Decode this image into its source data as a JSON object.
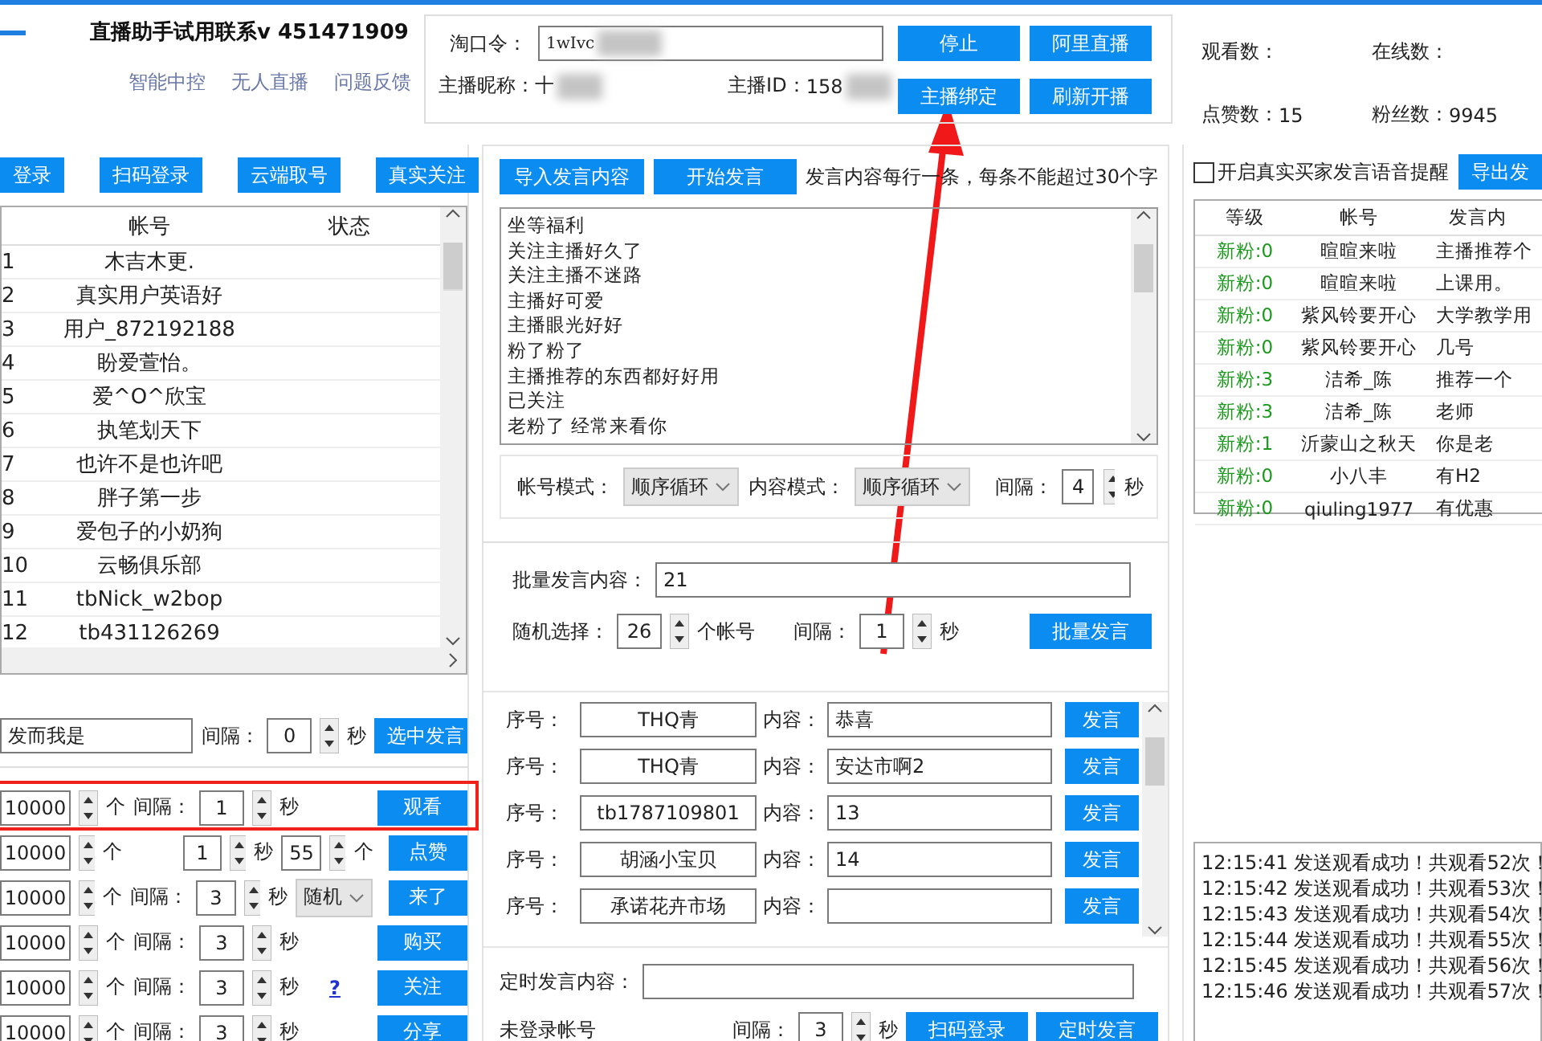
{
  "app": {
    "title": "直播助手试用联系v 451471909",
    "nav": [
      {
        "label": "智能中控"
      },
      {
        "label": "无人直播"
      },
      {
        "label": "问题反馈"
      }
    ]
  },
  "anchor": {
    "code_label": "淘口令：",
    "code_value": "1wIvc",
    "nickname_label": "主播昵称：",
    "nickname_value": "十",
    "id_label": "主播ID：",
    "id_value": "158",
    "buttons": [
      "停止",
      "阿里直播",
      "主播绑定",
      "刷新开播"
    ]
  },
  "stats": [
    {
      "label": "观看数："
    },
    {
      "label": "在线数："
    },
    {
      "label": "点赞数：",
      "value": "15"
    },
    {
      "label": "粉丝数：",
      "value": "9945"
    }
  ],
  "accounts": {
    "buttons": [
      "登录",
      "扫码登录",
      "云端取号",
      "真实关注"
    ],
    "columns": [
      "帐号",
      "状态"
    ],
    "rows": [
      {
        "index": "1",
        "account": "木吉木更."
      },
      {
        "index": "2",
        "account": "真实用户英语好"
      },
      {
        "index": "3",
        "account": "用户_872192188"
      },
      {
        "index": "4",
        "account": "盼爱萱怡。"
      },
      {
        "index": "5",
        "account": "爱^O^欣宝"
      },
      {
        "index": "6",
        "account": "执笔划天下"
      },
      {
        "index": "7",
        "account": "也许不是也许吧"
      },
      {
        "index": "8",
        "account": "胖子第一步"
      },
      {
        "index": "9",
        "account": "爱包子的小奶狗"
      },
      {
        "index": "10",
        "account": "云畅俱乐部"
      },
      {
        "index": "11",
        "account": "tbNick_w2bop"
      },
      {
        "index": "12",
        "account": "tb431126269"
      }
    ],
    "comment": "发而我是",
    "interval_label": "间隔：",
    "interval": "0",
    "unit": "秒",
    "send_button": "选中发言"
  },
  "actions": [
    {
      "count": "10000",
      "count_unit": "个",
      "label": "间隔：",
      "value": "1",
      "unit": "秒",
      "button": "观看"
    },
    {
      "count": "10000",
      "count_unit": "个",
      "value": "1",
      "unit": "秒",
      "amount": "55",
      "amount_unit": "个",
      "button": "点赞"
    },
    {
      "count": "10000",
      "count_unit": "个",
      "label": "间隔：",
      "value": "3",
      "unit": "秒",
      "option": "随机",
      "button": "来了"
    },
    {
      "count": "10000",
      "count_unit": "个",
      "label": "间隔：",
      "value": "3",
      "unit": "秒",
      "button": "购买"
    },
    {
      "count": "10000",
      "count_unit": "个",
      "label": "间隔：",
      "value": "3",
      "unit": "秒",
      "help": "?",
      "button": "关注"
    },
    {
      "count": "10000",
      "count_unit": "个",
      "label": "间隔：",
      "value": "3",
      "unit": "秒",
      "button": "分享"
    }
  ],
  "comments": {
    "import_button": "导入发言内容",
    "start_button": "开始发言",
    "hint": "发言内容每行一条，每条不能超过30个字",
    "lines": [
      "坐等福利",
      "关注主播好久了",
      "关注主播不迷路",
      "主播好可爱",
      "主播眼光好好",
      "粉了粉了",
      "主播推荐的东西都好好用",
      "已关注",
      "老粉了 经常来看你"
    ],
    "account_mode_label": "帐号模式：",
    "account_mode": "顺序循环",
    "content_mode_label": "内容模式：",
    "content_mode": "顺序循环",
    "interval_label": "间隔：",
    "interval": "4",
    "unit": "秒"
  },
  "batch": {
    "content_label": "批量发言内容：",
    "content": "21",
    "random_label": "随机选择：",
    "random": "26",
    "random_unit": "个帐号",
    "interval_label": "间隔：",
    "interval": "1",
    "unit": "秒",
    "button": "批量发言"
  },
  "directed": [
    {
      "index_label": "序号：",
      "account": "THQ青",
      "content_label": "内容：",
      "content": "恭喜",
      "button": "发言"
    },
    {
      "index_label": "序号：",
      "account": "THQ青",
      "content_label": "内容：",
      "content": "安达市啊2",
      "button": "发言"
    },
    {
      "index_label": "序号：",
      "account": "tb1787109801",
      "content_label": "内容：",
      "content": "13",
      "button": "发言"
    },
    {
      "index_label": "序号：",
      "account": "胡涵小宝贝",
      "content_label": "内容：",
      "content": "14",
      "button": "发言"
    },
    {
      "index_label": "序号：",
      "account": "承诺花卉市场",
      "content_label": "内容：",
      "button": "发言"
    }
  ],
  "timed": {
    "content_label": "定时发言内容：",
    "status": "未登录帐号",
    "interval_label": "间隔：",
    "interval": "3",
    "unit": "秒",
    "buttons": [
      "扫码登录",
      "定时发言"
    ]
  },
  "viewers": {
    "voice_alert": {
      "label": "开启真实买家发言语音提醒",
      "checked": false
    },
    "export_button": "导出发",
    "columns": [
      "等级",
      "帐号",
      "发言内"
    ],
    "rows": [
      {
        "level": "新粉:0",
        "account": "暄暄来啦",
        "content": "主播推荐个"
      },
      {
        "level": "新粉:0",
        "account": "暄暄来啦",
        "content": "上课用。"
      },
      {
        "level": "新粉:0",
        "account": "紫风铃要开心",
        "content": "大学教学用"
      },
      {
        "level": "新粉:0",
        "account": "紫风铃要开心",
        "content": "几号"
      },
      {
        "level": "新粉:3",
        "account": "洁希_陈",
        "content": "推荐一个"
      },
      {
        "level": "新粉:3",
        "account": "洁希_陈",
        "content": "老师"
      },
      {
        "level": "新粉:1",
        "account": "沂蒙山之秋天",
        "content": "你是老"
      },
      {
        "level": "新粉:0",
        "account": "小八丰",
        "content": "有H2"
      },
      {
        "level": "新粉:0",
        "account": "qiuling1977",
        "content": "有优惠"
      }
    ],
    "log": [
      "12:15:41 发送观看成功！共观看52次！",
      "12:15:42 发送观看成功！共观看53次！",
      "12:15:43 发送观看成功！共观看54次！",
      "12:15:44 发送观看成功！共观看55次！",
      "12:15:45 发送观看成功！共观看56次！",
      "12:15:46 发送观看成功！共观看57次！"
    ]
  }
}
